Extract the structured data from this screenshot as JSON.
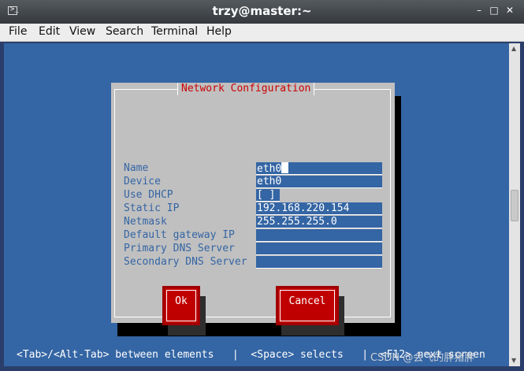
{
  "window": {
    "title": "trzy@master:~",
    "controls": [
      "–",
      "□",
      "✕"
    ]
  },
  "menu": [
    "File",
    "Edit",
    "View",
    "Search",
    "Terminal",
    "Help"
  ],
  "dialog": {
    "title": "Network Configuration",
    "fields": [
      {
        "label": "Name",
        "value": "eth0"
      },
      {
        "label": "Device",
        "value": "eth0"
      },
      {
        "label": "Use DHCP",
        "value": "[ ]"
      },
      {
        "label": "Static IP",
        "value": "192.168.220.154"
      },
      {
        "label": "Netmask",
        "value": "255.255.255.0"
      },
      {
        "label": "Default gateway IP",
        "value": ""
      },
      {
        "label": "Primary DNS Server",
        "value": ""
      },
      {
        "label": "Secondary DNS Server",
        "value": ""
      }
    ],
    "ok_label": "Ok",
    "cancel_label": "Cancel"
  },
  "status_bar": "<Tab>/<Alt-Tab> between elements   |  <Space> selects   |  <F12> next screen",
  "watermark": "CSDN @会飞的胖猪胖",
  "colors": {
    "terminal_bg": "#3465a4",
    "dialog_bg": "#c0c0c0",
    "button": "#c00000",
    "title_text": "#cc0000"
  }
}
